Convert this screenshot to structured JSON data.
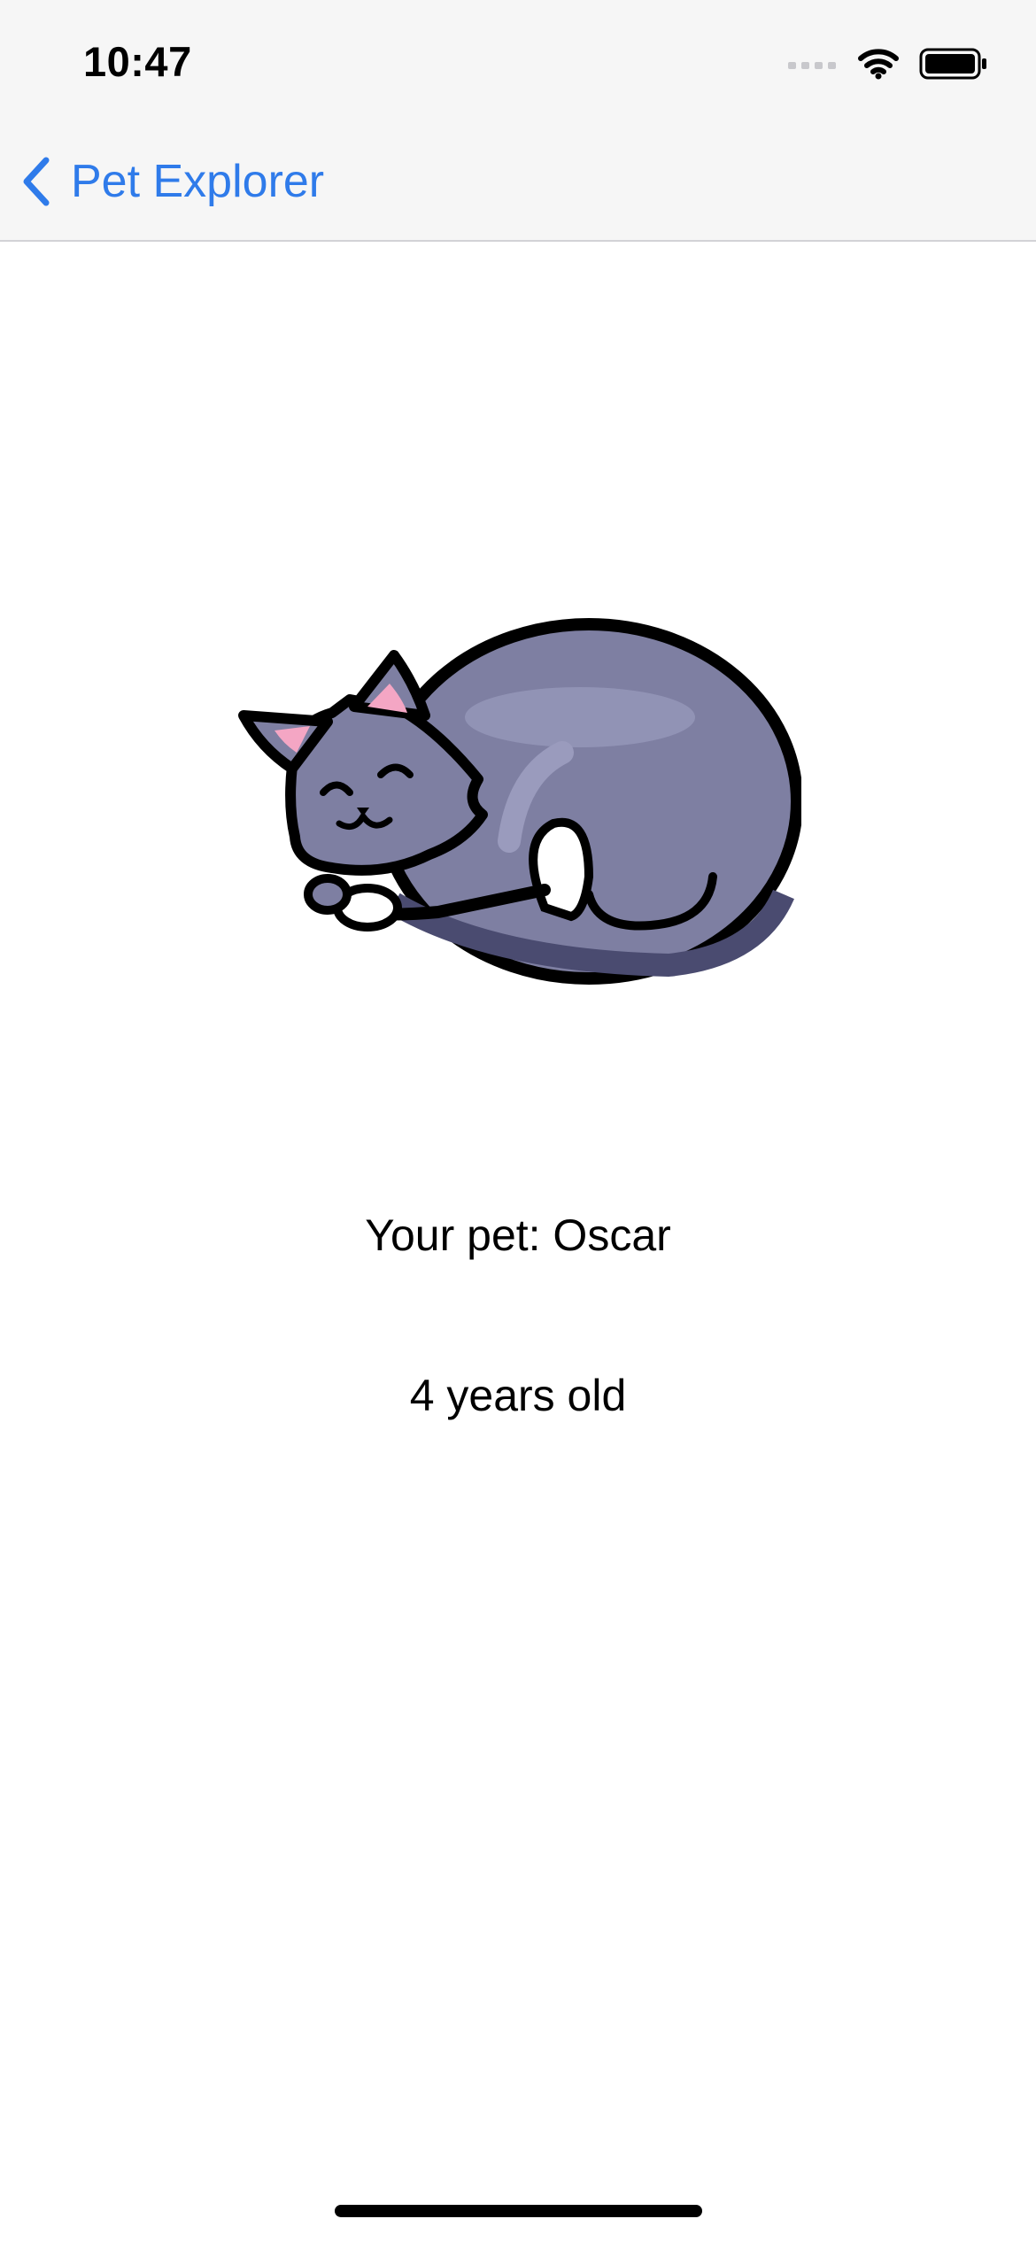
{
  "status_bar": {
    "time": "10:47",
    "signal_icon": "cellular-signal-icon",
    "wifi_icon": "wifi-icon",
    "battery_icon": "battery-icon"
  },
  "nav": {
    "back_icon": "chevron-left-icon",
    "back_label": "Pet Explorer"
  },
  "pet": {
    "image_icon": "sleeping-cat-illustration",
    "name_text": "Your pet: Oscar",
    "age_text": "4 years old"
  },
  "colors": {
    "accent": "#2f7bea",
    "cat_body": "#7e7fa2",
    "cat_shadow": "#4a4b70",
    "ear_pink": "#f4a6c4"
  }
}
